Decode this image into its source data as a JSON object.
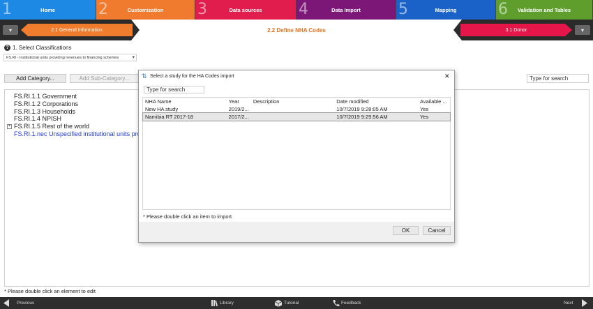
{
  "steps": [
    {
      "num": "1",
      "label": "Home",
      "color": "#1e88e5"
    },
    {
      "num": "2",
      "label": "Customization",
      "color": "#f07b2e"
    },
    {
      "num": "3",
      "label": "Data sources",
      "color": "#e01d4c"
    },
    {
      "num": "4",
      "label": "Data Import",
      "color": "#7c1677"
    },
    {
      "num": "5",
      "label": "Mapping",
      "color": "#1a62c8"
    },
    {
      "num": "6",
      "label": "Validation and Tables",
      "color": "#5f9e2d"
    }
  ],
  "substeps": {
    "prev": "2.1 General Information",
    "current": "2.2 Define NHA Codes",
    "next": "3.1 Donor"
  },
  "main": {
    "select_label": "1. Select Classifications",
    "classification_value": "FS.RI - Institutional units providing revenues to financing schemes",
    "add_category": "Add Category...",
    "add_subcategory": "Add Sub-Category...",
    "search_placeholder": "Type for search",
    "tree": [
      {
        "expander": "",
        "label": "FS.RI.1.1 Government",
        "blue": false
      },
      {
        "expander": "",
        "label": "FS.RI.1.2 Corporations",
        "blue": false
      },
      {
        "expander": "",
        "label": "FS.RI.1.3 Households",
        "blue": false
      },
      {
        "expander": "",
        "label": "FS.RI.1.4 NPISH",
        "blue": false
      },
      {
        "expander": "+",
        "label": "FS.RI.1.5 Rest of the world",
        "blue": false
      },
      {
        "expander": "",
        "label": "FS.RI.1.nec Unspecified institutional units prov",
        "blue": true
      }
    ],
    "footer_hint": "* Please double click an element to edit"
  },
  "dialog": {
    "title": "Select a study for the HA Codes import",
    "close": "✕",
    "search_placeholder": "Type for search",
    "columns": [
      "NHA Name",
      "Year",
      "Description",
      "Date modified",
      "Available ..."
    ],
    "rows": [
      {
        "name": "New HA study",
        "year": "2019/2...",
        "description": "",
        "date": "10/7/2019 9:28:05 AM",
        "available": "Yes"
      },
      {
        "name": "Namibia RT 2017-18",
        "year": "2017/2...",
        "description": "",
        "date": "10/7/2019 9:29:56 AM",
        "available": "Yes"
      }
    ],
    "hint": "* Please double click an item to import",
    "ok": "OK",
    "cancel": "Cancel"
  },
  "bottombar": {
    "previous": "Previous",
    "library": "Library",
    "tutorial": "Tutorial",
    "feedback": "Feedback",
    "next": "Next"
  }
}
